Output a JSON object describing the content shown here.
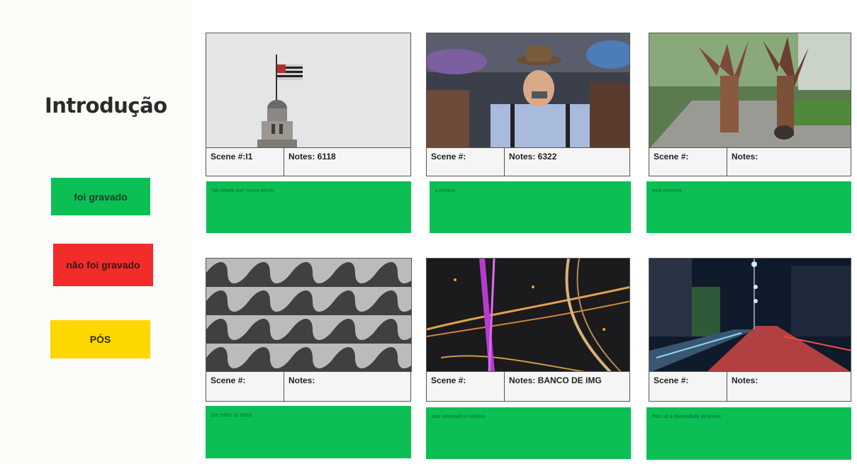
{
  "sidebar": {
    "title": "Introdução",
    "legend": {
      "recorded": "foi gravado",
      "not_recorded": "não foi gravado",
      "post": "PÓS"
    }
  },
  "colors": {
    "recorded": "#0bbf55",
    "not_recorded": "#f32b2b",
    "post": "#ffd700"
  },
  "cards": [
    {
      "scene": "Scene #:I1",
      "notes": "Notes: 6118",
      "caption": "Na cidade que nunca dorme",
      "image": "flag-tower-image"
    },
    {
      "scene": "Scene #:",
      "notes": "Notes: 6322",
      "caption": "a música",
      "image": "harmonica-player-image"
    },
    {
      "scene": "Scene #:",
      "notes": "Notes:",
      "caption": "está presente",
      "image": "feather-dancers-image"
    },
    {
      "scene": "Scene #:",
      "notes": "Notes:",
      "caption": "por todos os lados",
      "image": "sidewalk-pattern-image"
    },
    {
      "scene": "Scene #:",
      "notes": "Notes: BANCO DE IMG",
      "caption": "que conectam o coletivo",
      "image": "night-bridge-image"
    },
    {
      "scene": "Scene #:",
      "notes": "Notes:",
      "caption": "Pois só a diversidade de povos",
      "image": "avenue-night-image"
    }
  ]
}
